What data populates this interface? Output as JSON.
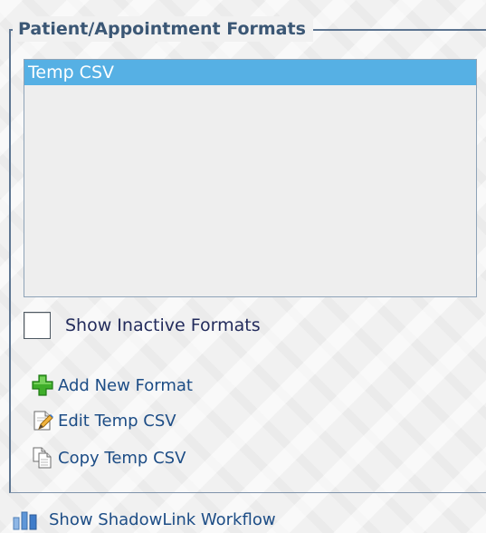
{
  "panel": {
    "legend": "Patient/Appointment Formats",
    "list_items": [
      "Temp CSV"
    ],
    "selected_index": 0
  },
  "show_inactive": {
    "label": "Show Inactive Formats",
    "checked": false
  },
  "actions": {
    "add": {
      "label": "Add New Format",
      "icon": "green-plus-icon"
    },
    "edit": {
      "label": "Edit Temp CSV",
      "icon": "edit-document-icon"
    },
    "copy": {
      "label": "Copy Temp CSV",
      "icon": "copy-documents-icon"
    }
  },
  "workflow": {
    "label": "Show ShadowLink Workflow",
    "icon": "workflow-bars-icon"
  },
  "colors": {
    "legend_text": "#3b5775",
    "link_text": "#1d4d86",
    "selection": "#56b0e4",
    "border": "#5d7591"
  }
}
